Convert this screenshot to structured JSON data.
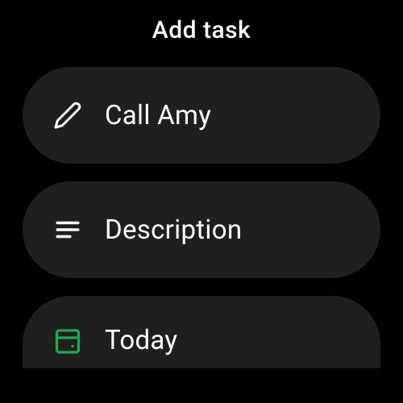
{
  "title": "Add task",
  "rows": {
    "title": {
      "label": "Call Amy"
    },
    "description": {
      "label": "Description"
    },
    "date": {
      "label": "Today"
    }
  },
  "colors": {
    "accent": "#1ea94d"
  }
}
